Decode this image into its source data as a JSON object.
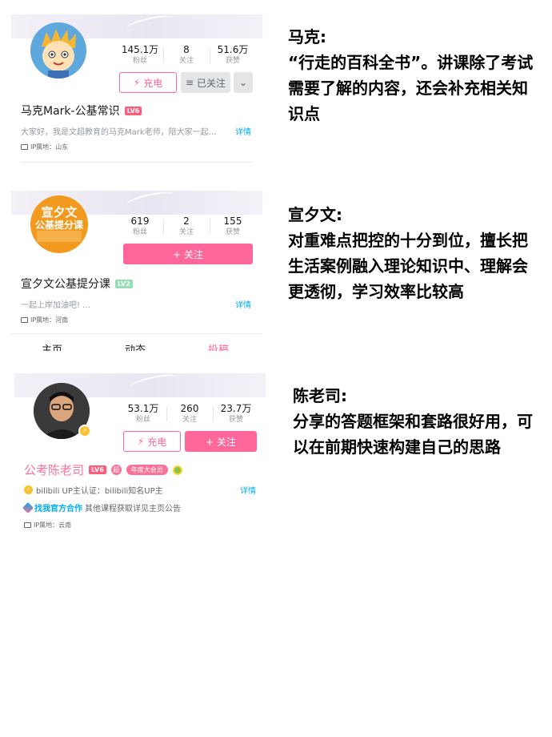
{
  "profiles": [
    {
      "avatar": "cartoon-mascot-avatar",
      "stats": [
        {
          "value": "145.1万",
          "label": "粉丝"
        },
        {
          "value": "8",
          "label": "关注"
        },
        {
          "value": "51.6万",
          "label": "获赞"
        }
      ],
      "charge_label": "充电",
      "followed_label": "已关注",
      "name": "马克Mark-公基常识",
      "level": "LV6",
      "bio": "大家好，我是文超教育的马克Mark老师，陪大家一起…",
      "detail_label": "详情",
      "ip": "IP属地：山东"
    },
    {
      "avatar_text": [
        "宣夕文",
        "公基提分课"
      ],
      "stats": [
        {
          "value": "619",
          "label": "粉丝"
        },
        {
          "value": "2",
          "label": "关注"
        },
        {
          "value": "155",
          "label": "获赞"
        }
      ],
      "follow_label": "+ 关注",
      "name": "宣夕文公基提分课",
      "level": "LV2",
      "bio": "一起上岸加油吧! …",
      "detail_label": "详情",
      "ip": "IP属地：河南",
      "tabs": [
        "主页",
        "动态",
        "投稿"
      ]
    },
    {
      "avatar": "person-photo-avatar",
      "stats": [
        {
          "value": "53.1万",
          "label": "粉丝"
        },
        {
          "value": "260",
          "label": "关注"
        },
        {
          "value": "23.7万",
          "label": "获赞"
        }
      ],
      "charge_label": "充电",
      "follow_label": "+ 关注",
      "name": "公考陈老司",
      "level": "LV6",
      "badge_super": "超",
      "badge_annual": "年度大会员",
      "verify": "bilibili UP主认证：bilibili知名UP主",
      "cooperation_link": "找我官方合作",
      "cooperation_text": "其他课程获取详见主页公告",
      "detail_label": "详情",
      "ip": "IP属地：云南"
    }
  ],
  "comments": [
    {
      "name": "马克:",
      "text": "“行走的百科全书”。讲课除了考试需要了解的内容，还会补充相关知识点"
    },
    {
      "name": "宣夕文:",
      "text": "对重难点把控的十分到位，擅长把生活案例融入理论知识中、理解会更透彻，学习效率比较高"
    },
    {
      "name": "陈老司:",
      "text": "分享的答题框架和套路很好用，可以在前期快速构建自己的思路"
    }
  ],
  "colors": {
    "pink": "#ff6699",
    "blue_link": "#00aeec",
    "gray_text": "#9499a0"
  }
}
